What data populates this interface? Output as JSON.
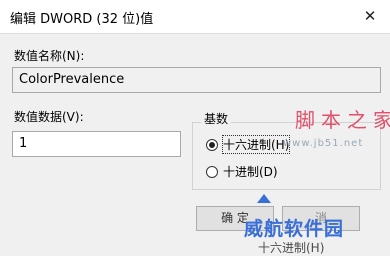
{
  "window": {
    "title": "编辑 DWORD (32 位)值",
    "close_glyph": "✕"
  },
  "value_name": {
    "label": "数值名称(N):",
    "value": "ColorPrevalence"
  },
  "value_data": {
    "label": "数值数据(V):",
    "value": "1"
  },
  "base": {
    "label": "基数",
    "options": [
      {
        "label": "十六进制(H)",
        "selected": true
      },
      {
        "label": "十进制(D)",
        "selected": false
      }
    ]
  },
  "buttons": {
    "ok_partial": "确 定",
    "cancel_partial": "消"
  },
  "watermark": {
    "top": "脚本之家",
    "url": "www.jb51.net",
    "bottom": "威航软件园",
    "ghost_label": "十六进制(H)"
  },
  "colors": {
    "background": "#f0f0f0",
    "watermark_red": "#e0506a",
    "watermark_blue": "#3a6fd8"
  },
  "icons": {
    "close": "close-icon",
    "cursor": "pointer-cursor-icon"
  }
}
